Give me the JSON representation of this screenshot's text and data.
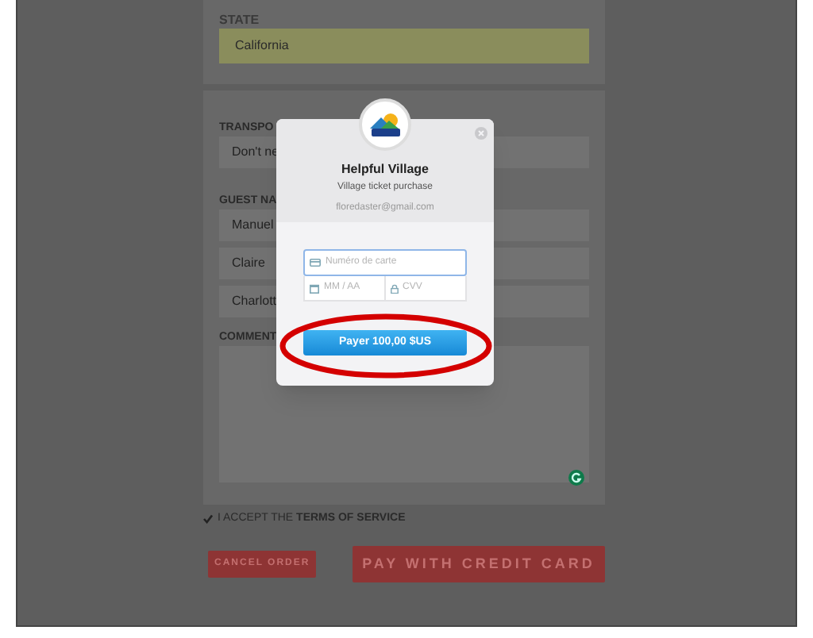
{
  "state_section": {
    "label": "STATE",
    "value": "California"
  },
  "transport_section": {
    "label": "TRANSPO",
    "value": "Don't ne"
  },
  "guest_section": {
    "label": "GUEST NA",
    "guests": [
      "Manuel",
      "Claire",
      "Charlott"
    ]
  },
  "comments_section": {
    "label": "COMMENT"
  },
  "terms": {
    "checked": true,
    "text": "I ACCEPT THE **TERMS OF SERVICE**"
  },
  "buttons": [
    {
      "label": "CANCEL ORDER",
      "kind": "secondary"
    },
    {
      "label": "PAY WITH CREDIT CARD",
      "kind": "primary"
    }
  ],
  "payment_dialog": {
    "title": "Helpful Village",
    "subtitle": "Village ticket purchase",
    "email": "floredaster@gmail.com",
    "card_number_placeholder": "Numéro de carte",
    "expiry_placeholder": "MM / AA",
    "cvv_placeholder": "CVV",
    "pay_button": "Payer 100,00 $US"
  }
}
